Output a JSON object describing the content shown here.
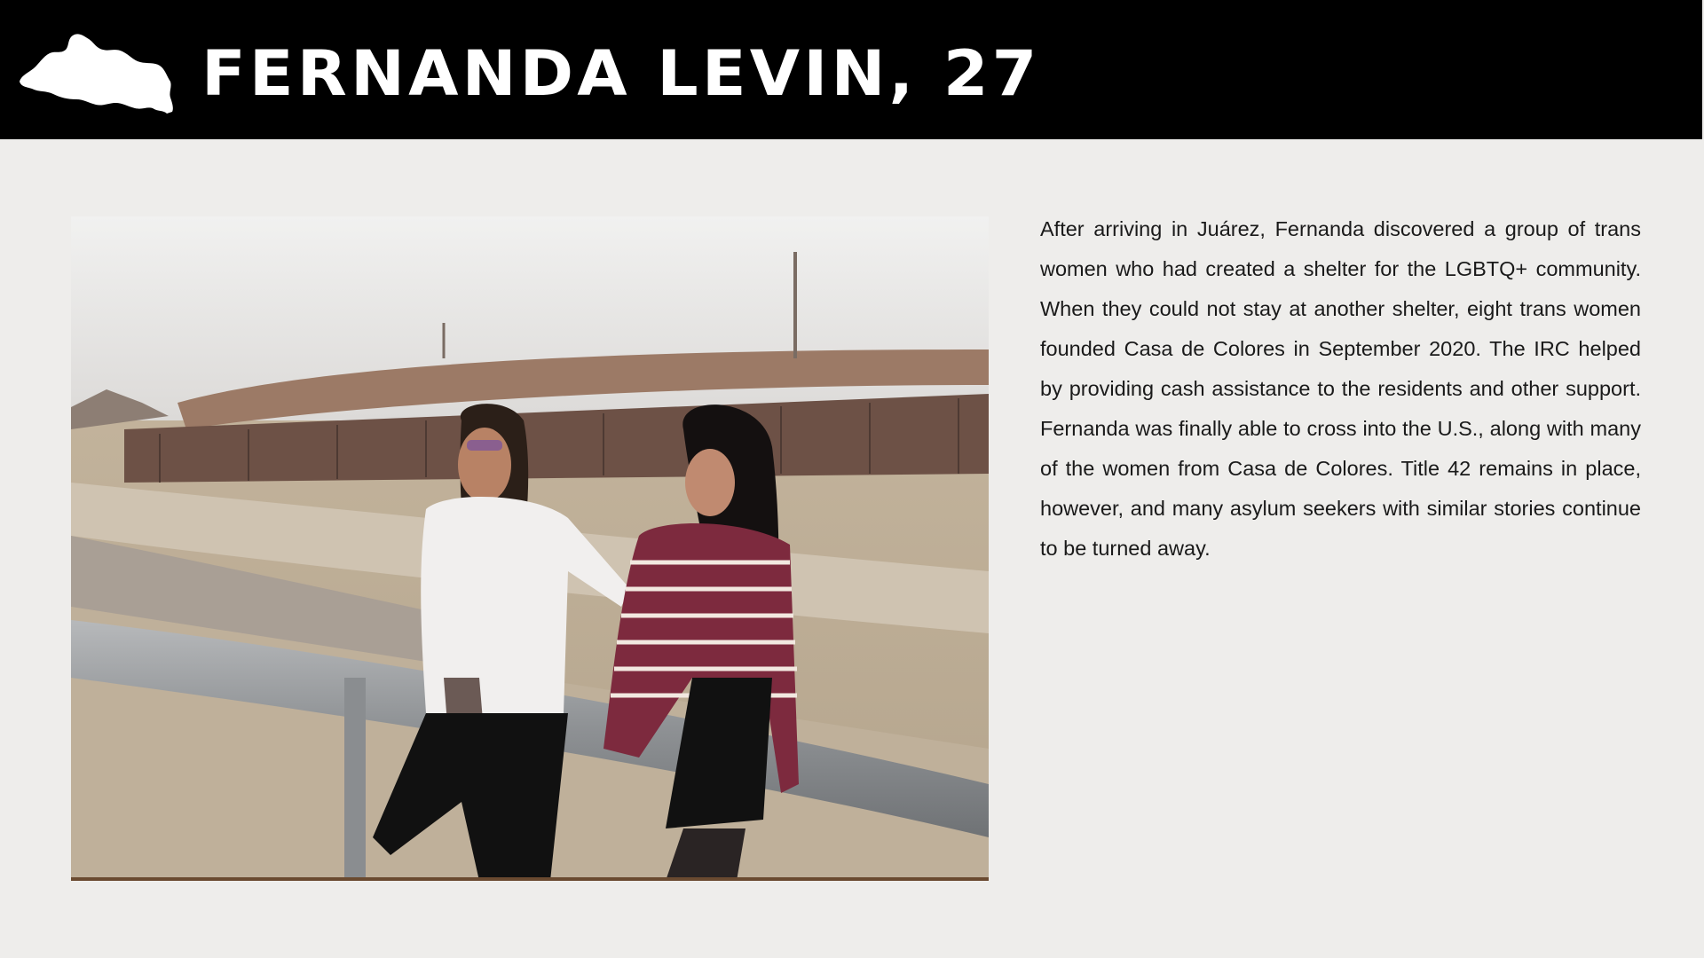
{
  "header": {
    "title": "FERNANDA LEVIN, 27",
    "country_icon": "el-salvador-map-icon",
    "background": "#000000",
    "title_color": "#ffffff"
  },
  "photo": {
    "subject": "photo-two-women-at-riverside-railing"
  },
  "body": {
    "text": "After arriving in Juárez, Fernanda discovered a group of trans women who had created a shelter for the LGBTQ+ community. When they could not stay at another shelter, eight trans women founded Casa de Colores in September 2020. The IRC helped by providing cash assistance to the residents and other support. Fernanda was finally able to cross into the U.S., along with many of the women from Casa de Colores. Title 42 remains in place, however, and many asylum seekers with similar stories continue to be turned away."
  },
  "colors": {
    "page_background": "#eeedeb",
    "text": "#1a1a1a"
  }
}
